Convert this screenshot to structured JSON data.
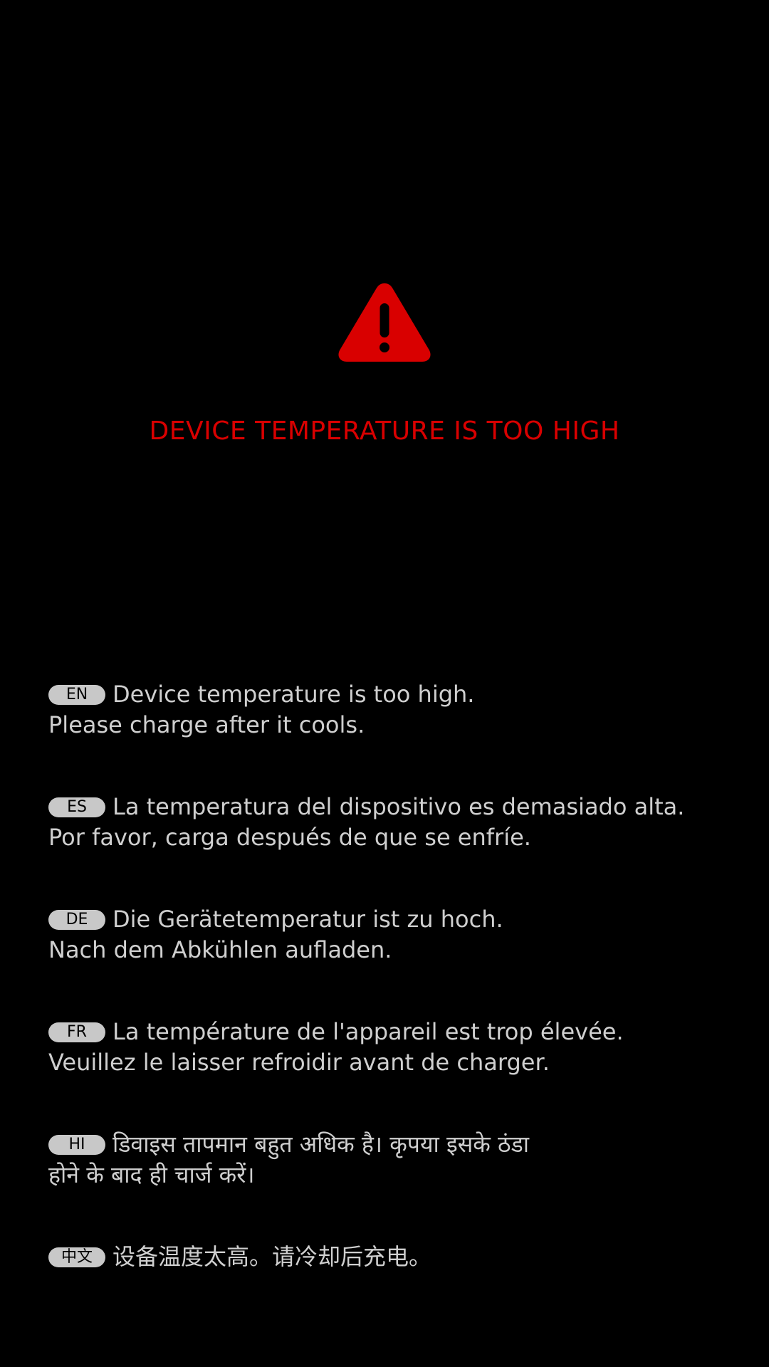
{
  "alert": {
    "icon": "warning-triangle-icon",
    "accent_color": "#d90000",
    "headline": "DEVICE TEMPERATURE IS TOO HIGH"
  },
  "messages": [
    {
      "lang": "EN",
      "line1": "Device temperature is too high.",
      "line2": "Please charge after it cools."
    },
    {
      "lang": "ES",
      "line1": "La temperatura del dispositivo es demasiado alta.",
      "line2": "Por favor, carga después de que se enfríe."
    },
    {
      "lang": "DE",
      "line1": "Die Gerätetemperatur ist zu hoch.",
      "line2": "Nach dem Abkühlen aufladen."
    },
    {
      "lang": "FR",
      "line1": "La température de l'appareil est trop élevée.",
      "line2": "Veuillez le laisser refroidir avant de charger."
    },
    {
      "lang": "HI",
      "line1": "डिवाइस तापमान बहुत अधिक है। कृपया इसके ठंडा",
      "line2": "होने के बाद ही चार्ज करें।"
    },
    {
      "lang": "中文",
      "line1": "设备温度太高。请冷却后充电。",
      "line2": ""
    }
  ]
}
